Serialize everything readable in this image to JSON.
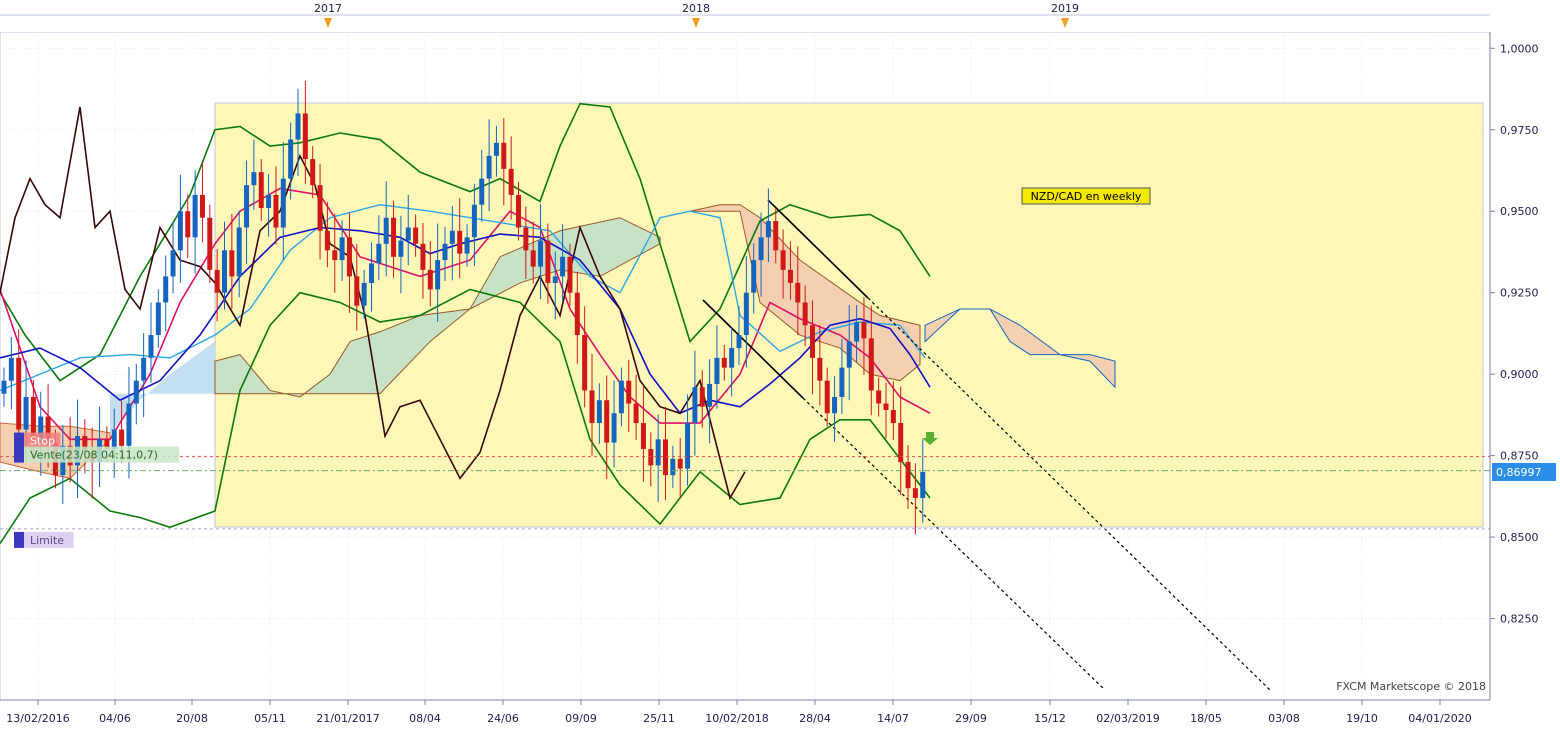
{
  "chart_data": {
    "type": "candlestick",
    "instrument_label": "NZD/CAD en weekly",
    "watermark": "FXCM Marketscope © 2018",
    "current_price": "0,86997",
    "ylim": [
      0.8,
      1.005
    ],
    "y_ticks": [
      "1,0000",
      "0,9750",
      "0,9500",
      "0,9250",
      "0,9000",
      "0,8750",
      "0,8500",
      "0,8250"
    ],
    "y_tick_values": [
      1.0,
      0.975,
      0.95,
      0.925,
      0.9,
      0.875,
      0.85,
      0.825
    ],
    "x_tick_labels": [
      "13/02/2016",
      "04/06",
      "20/08",
      "05/11",
      "21/01/2017",
      "08/04",
      "24/06",
      "09/09",
      "25/11",
      "10/02/2018",
      "28/04",
      "14/07",
      "29/09",
      "15/12",
      "02/03/2019",
      "18/05",
      "03/08",
      "19/10",
      "04/01/2020"
    ],
    "year_markers": [
      "2017",
      "2018",
      "2019"
    ],
    "order_labels": {
      "stop": "Stop",
      "sell": "Vente(23/08 04:11,0,7)",
      "limit": "Limite"
    },
    "levels": {
      "stop": 0.8747,
      "sell": 0.8704,
      "limit": 0.8525
    },
    "colors": {
      "bull": "#1565c0",
      "bear": "#d01818",
      "bollinger": "#0a7a0a",
      "kijun": "#e0106a",
      "tenkan": "#2aa8e8",
      "sma": "#1010c8",
      "chikou": "#3a0606",
      "highlight": "#fdf7b8",
      "kumo_bull": "#c8e2c6",
      "kumo_bear": "#f4d0b0",
      "kumo_blue": "#c4dff0"
    },
    "candles_weekly_close": [
      0.898,
      0.905,
      0.883,
      0.893,
      0.88,
      0.887,
      0.879,
      0.869,
      0.878,
      0.872,
      0.881,
      0.876,
      0.873,
      0.88,
      0.877,
      0.883,
      0.878,
      0.891,
      0.898,
      0.905,
      0.912,
      0.922,
      0.93,
      0.938,
      0.95,
      0.942,
      0.955,
      0.948,
      0.932,
      0.925,
      0.938,
      0.93,
      0.945,
      0.958,
      0.962,
      0.951,
      0.955,
      0.945,
      0.96,
      0.972,
      0.98,
      0.966,
      0.958,
      0.944,
      0.938,
      0.935,
      0.942,
      0.93,
      0.921,
      0.928,
      0.934,
      0.94,
      0.948,
      0.936,
      0.941,
      0.945,
      0.94,
      0.932,
      0.926,
      0.935,
      0.94,
      0.944,
      0.937,
      0.942,
      0.952,
      0.96,
      0.967,
      0.971,
      0.963,
      0.955,
      0.945,
      0.938,
      0.933,
      0.941,
      0.928,
      0.93,
      0.936,
      0.925,
      0.912,
      0.895,
      0.885,
      0.892,
      0.879,
      0.888,
      0.898,
      0.891,
      0.885,
      0.877,
      0.872,
      0.88,
      0.869,
      0.874,
      0.871,
      0.885,
      0.896,
      0.89,
      0.897,
      0.905,
      0.902,
      0.908,
      0.912,
      0.925,
      0.935,
      0.942,
      0.947,
      0.938,
      0.932,
      0.928,
      0.922,
      0.915,
      0.905,
      0.898,
      0.888,
      0.893,
      0.902,
      0.91,
      0.916,
      0.911,
      0.895,
      0.891,
      0.889,
      0.885,
      0.873,
      0.865,
      0.862,
      0.87
    ]
  }
}
